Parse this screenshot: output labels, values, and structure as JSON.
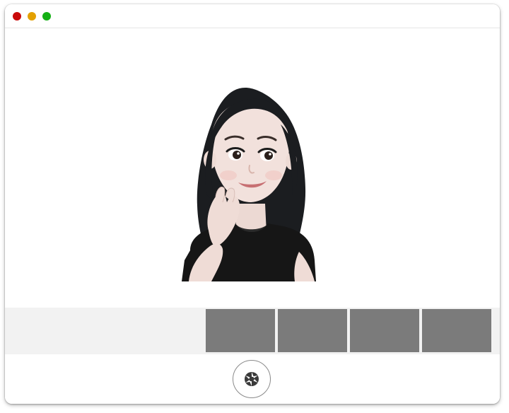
{
  "window": {
    "controls": [
      {
        "name": "close",
        "color": "#c90a0a"
      },
      {
        "name": "minimize",
        "color": "#e3a000"
      },
      {
        "name": "zoom",
        "color": "#15b015"
      }
    ]
  },
  "preview": {
    "subject": "memoji-avatar"
  },
  "thumbnails": {
    "count": 4,
    "color": "#7b7b7b"
  },
  "shutter": {
    "icon": "camera-aperture-icon"
  }
}
